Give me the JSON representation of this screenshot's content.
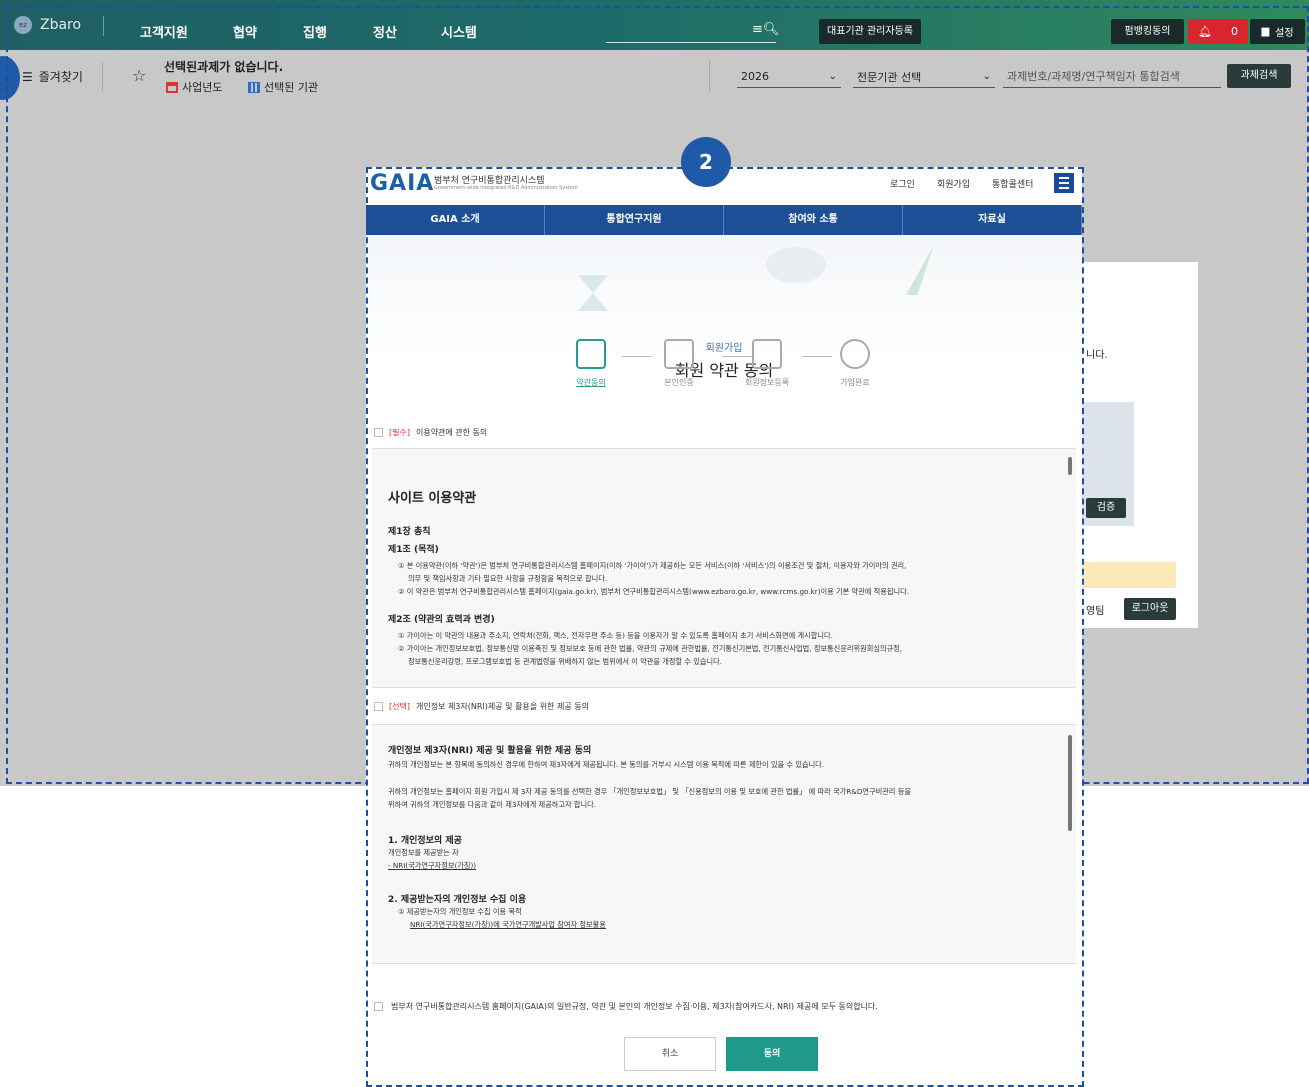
{
  "app": {
    "name": "Zbaro",
    "menu": [
      "고객지원",
      "협약",
      "집행",
      "정산",
      "시스템"
    ],
    "admin_register": "대표기관 관리자등록",
    "firmbanking": "펌뱅킹동의",
    "alarm_count": "0",
    "settings": "설정"
  },
  "subbar": {
    "favorites": "즐겨찾기",
    "no_task": "선택된과제가 없습니다.",
    "year_label": "사업년도",
    "org_label": "선택된 기관",
    "year_value": "2026",
    "agency_select": "전문기관 선택",
    "search_placeholder": "과제번호/과제명/연구책임자 통합검색",
    "search_button": "과제검색"
  },
  "bgpanel": {
    "text_fragment": "니다.",
    "verify": "검증",
    "team_fragment": "영팀",
    "logout": "로그아웃"
  },
  "badges": {
    "two": "2"
  },
  "gaia": {
    "logo": "GAIA",
    "system_name": "범부처 연구비통합관리시스템",
    "system_name_en": "Government-wide Integrated R&D Administration System",
    "links": [
      "로그인",
      "회원가입",
      "통합콜센터"
    ],
    "nav": [
      "GAIA 소개",
      "통합연구지원",
      "참여와 소통",
      "자료실"
    ],
    "kicker": "회원가입",
    "title": "회원 약관 동의",
    "steps": [
      "약관동의",
      "본인인증",
      "회원정보등록",
      "가입완료"
    ],
    "agree1_req": "[필수]",
    "agree1_text": "이용약관에 관한 동의",
    "terms": {
      "heading": "사이트 이용약관",
      "chapter1": "제1장 총칙",
      "article1": "제1조 (목적)",
      "a1_p1": "① 본 이용약관(이하 '약관')은 범부처 연구비통합관리시스템 홈페이지(이하 '가이아')가 제공하는 모든 서비스(이하 '서비스')의 이용조건 및 절차, 이용자와 가이아의 권리,",
      "a1_p1b": "의무 및 책임사항과 기타 필요한 사항을 규정함을 목적으로 합니다.",
      "a1_p2": "② 이 약관은 범부처 연구비통합관리시스템 홈페이지(gaia.go.kr), 범부처 연구비통합관리시스템(www.ezbaro.go.kr, www.rcms.go.kr)이용 기본 약관에 적용됩니다.",
      "article2": "제2조 (약관의 효력과 변경)",
      "a2_p1": "① 가이아는 이 약관의 내용과 주소지, 연락처(전화, 팩스, 전자우편 주소 등) 등을 이용자가 알 수 있도록 홈페이지 초기 서비스화면에 게시합니다.",
      "a2_p2": "② 가이아는 개인정보보호법, 정보통신망 이용촉진 및 정보보호 등에 관한 법률, 약관의 규제에 관한법률, 전기통신기본법, 전기통신사업법, 정보통신윤리위원회심의규정,",
      "a2_p2b": "정보통신윤리강령, 프로그램보호법 등 관계법령을 위배하지 않는 범위에서 이 약관을 개정할 수 있습니다."
    },
    "agree2_opt": "[선택]",
    "agree2_text": "개인정보 제3자(NRI)제공 및 활용을 위한 제공 동의",
    "privacy": {
      "heading": "개인정보 제3자(NRI) 제공 및 활용을 위한 제공 동의",
      "p1": "귀하의 개인정보는 본 항목에 동의하신 경우에 한하여 제3자에게 제공됩니다. 본 동의를 거부시 시스템 이용 목적에 따른 제한이 있을 수 있습니다.",
      "p2": "귀하의 개인정보는 홈페이지 회원 가입시 제 3자 제공 동의를 선택한 경우 「개인정보보호법」 및 「신용정보의 이용 및 보호에 관한 법률」 에 따라 국가R&D연구비관리 등을",
      "p2b": "위하여 귀하의 개인정보를 다음과 같이 제3자에게 제공하고자 합니다.",
      "s1": "1. 개인정보의 제공",
      "s1_a": "개인정보를 제공받는 자",
      "s1_b": "- NRI(국가연구자정보(가칭))",
      "s2": "2. 제공받는자의 개인정보 수집 이용",
      "s2_a": "① 제공받는자의 개인정보 수집 이용 목적",
      "s2_b": "NRI(국가연구자정보(가칭))에 국가연구개발사업 참여자 정보활용"
    },
    "final_agree": "범부처 연구비통합관리시스템 홈페이지(GAIA)의 일반규정, 약관 및 본인의 개인정보 수집·이용, 제3자(참여카드사, NRI) 제공에 모두 동의합니다.",
    "cancel": "취소",
    "confirm": "동의"
  }
}
